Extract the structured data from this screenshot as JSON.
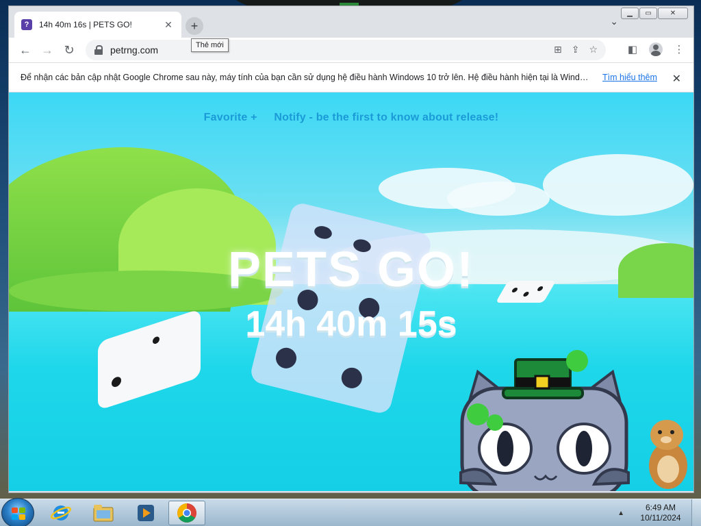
{
  "browser": {
    "tab": {
      "title": "14h 40m 16s | PETS GO!",
      "favicon_label": "?",
      "close_icon": "close-icon"
    },
    "new_tab_tooltip": "Thẻ mới",
    "address": {
      "url": "petrng.com"
    },
    "infobar": {
      "message": "Để nhận các bản cập nhật Google Chrome sau này, máy tính của bạn cần sử dụng hệ điều hành Windows 10 trở lên. Hệ điều hành hiện tại là Wind…",
      "link": "Tìm hiểu thêm"
    }
  },
  "page": {
    "nav": {
      "favorite": "Favorite +",
      "notify": "Notify - be the first to know about release!"
    },
    "logo": "PETS GO!",
    "countdown": "14h 40m 15s"
  },
  "taskbar": {
    "time": "6:49 AM",
    "date": "10/11/2024"
  },
  "colors": {
    "accent_link": "#1a73e8",
    "nav_text": "#1a9ad6",
    "sky": "#3cd8f5"
  }
}
